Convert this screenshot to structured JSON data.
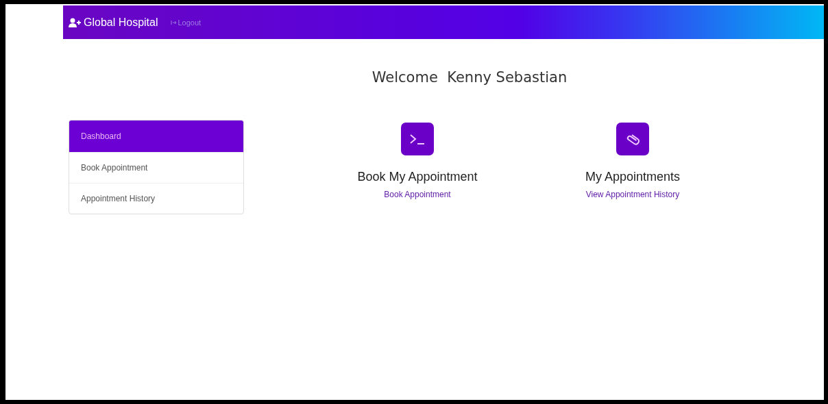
{
  "navbar": {
    "brand": "Global Hospital",
    "logout": "Logout"
  },
  "welcome": {
    "greeting": "Welcome",
    "name": "Kenny Sebastian"
  },
  "sidebar": {
    "items": [
      {
        "label": "Dashboard",
        "selected": true
      },
      {
        "label": "Book Appointment",
        "selected": false
      },
      {
        "label": "Appointment History",
        "selected": false
      }
    ]
  },
  "cards": [
    {
      "kind": "terminal",
      "title": "Book My Appointment",
      "link": "Book Appointment"
    },
    {
      "kind": "attachment",
      "title": "My Appointments",
      "link": "View Appointment History"
    }
  ]
}
